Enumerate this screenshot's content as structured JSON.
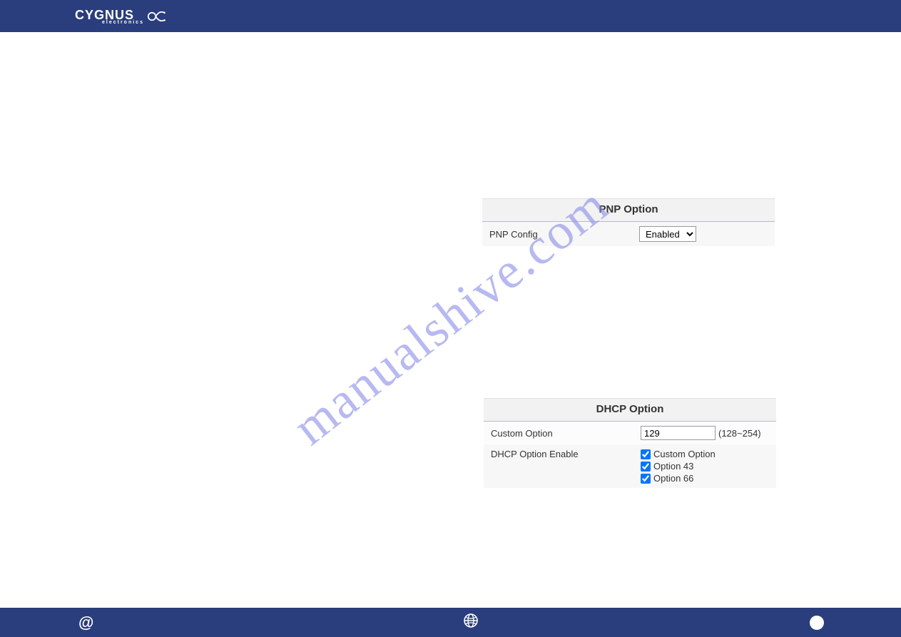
{
  "header": {
    "brand_main": "CYGNUS",
    "brand_sub": "electronics"
  },
  "watermark_text": "manualshive.com",
  "pnp": {
    "title": "PNP Option",
    "config_label": "PNP Config",
    "config_value": "Enabled"
  },
  "dhcp": {
    "title": "DHCP Option",
    "custom_option_label": "Custom Option",
    "custom_option_value": "129",
    "custom_option_range": "(128~254)",
    "enable_label": "DHCP Option Enable",
    "options": [
      {
        "label": "Custom Option",
        "checked": true
      },
      {
        "label": "Option 43",
        "checked": true
      },
      {
        "label": "Option 66",
        "checked": true
      }
    ]
  }
}
